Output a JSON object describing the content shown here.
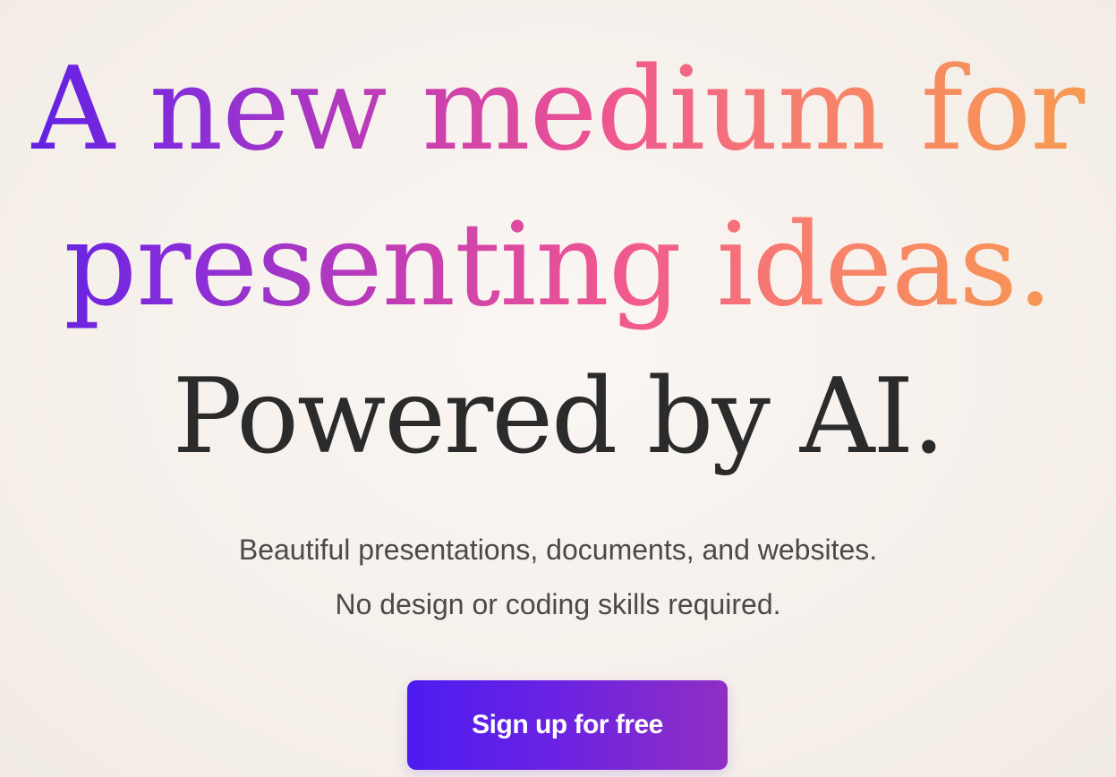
{
  "hero": {
    "headline_line1": "A new medium for",
    "headline_line2": "presenting ideas.",
    "headline_line3": "Powered by AI.",
    "subtitle_line1": "Beautiful presentations, documents, and websites.",
    "subtitle_line2": "No design or coding skills required.",
    "cta_label": "Sign up for free"
  },
  "colors": {
    "gradient_start": "#5a1ee6",
    "gradient_mid": "#f0578f",
    "gradient_end": "#f79c4e",
    "headline_dark": "#2b2b2b",
    "button_start": "#4c1cf0",
    "button_end": "#8f2fc4",
    "background": "#f7f2ee"
  }
}
